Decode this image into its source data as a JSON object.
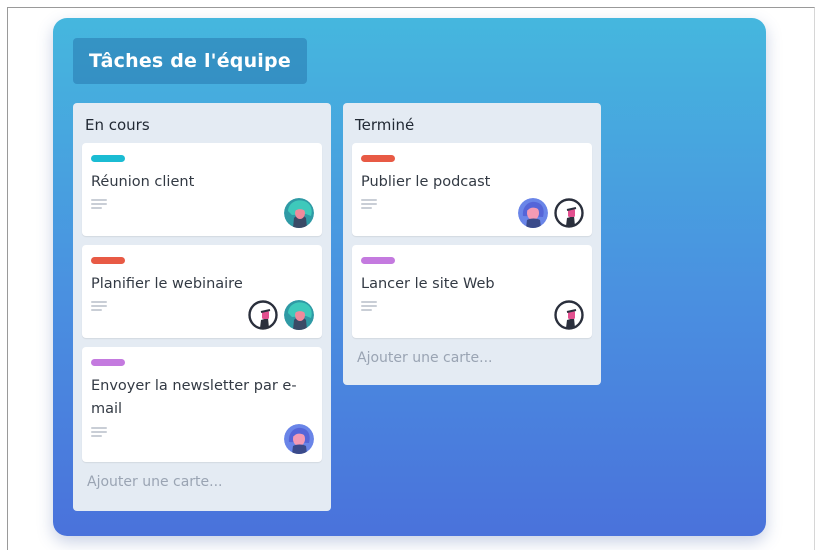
{
  "board": {
    "title": "Tâches de l'équipe"
  },
  "lists": [
    {
      "title": "En cours",
      "add_card_label": "Ajouter une carte...",
      "cards": [
        {
          "title": "Réunion client",
          "label_color": "#1bbcd3"
        },
        {
          "title": "Planifier le webinaire",
          "label_color": "#e85a45"
        },
        {
          "title": "Envoyer la newsletter par e-mail",
          "label_color": "#c47adf"
        }
      ]
    },
    {
      "title": "Terminé",
      "add_card_label": "Ajouter une carte...",
      "cards": [
        {
          "title": "Publier le podcast",
          "label_color": "#e85a45"
        },
        {
          "title": "Lancer le site Web",
          "label_color": "#c47adf"
        }
      ]
    }
  ],
  "icons": {
    "description": "description-lines-icon",
    "avatar_teal": "avatar-teal-hair-icon",
    "avatar_outline": "avatar-outline-icon",
    "avatar_blue": "avatar-blue-icon"
  },
  "colors": {
    "board_top": "#45b7de",
    "board_bottom": "#4a72db",
    "list_bg": "#e4ebf3"
  }
}
